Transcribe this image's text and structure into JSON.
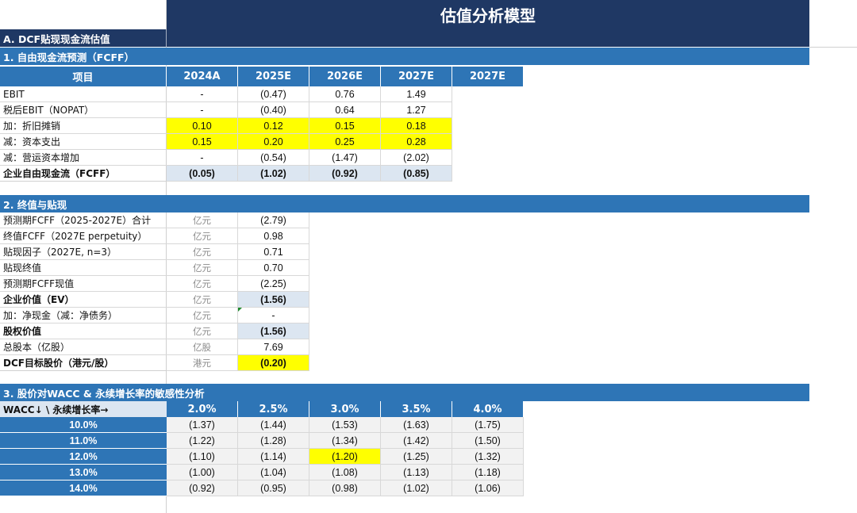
{
  "title": "估值分析模型",
  "sectionA": "A. DCF贴现现金流估值",
  "section1": {
    "heading": "1. 自由现金流预测（FCFF）",
    "col_label": "项目",
    "years": [
      "2024A",
      "2025E",
      "2026E",
      "2027E",
      "2027E"
    ],
    "rows": [
      {
        "label": "EBIT",
        "values": [
          "-",
          "(0.47)",
          "0.76",
          "1.49"
        ]
      },
      {
        "label": "税后EBIT（NOPAT）",
        "values": [
          "-",
          "(0.40)",
          "0.64",
          "1.27"
        ]
      },
      {
        "label": "加：折旧摊销",
        "values": [
          "0.10",
          "0.12",
          "0.15",
          "0.18"
        ]
      },
      {
        "label": "减：资本支出",
        "values": [
          "0.15",
          "0.20",
          "0.25",
          "0.28"
        ]
      },
      {
        "label": "减：营运资本增加",
        "values": [
          "-",
          "(0.54)",
          "(1.47)",
          "(2.02)"
        ]
      },
      {
        "label": "企业自由现金流（FCFF）",
        "values": [
          "(0.05)",
          "(1.02)",
          "(0.92)",
          "(0.85)"
        ]
      }
    ]
  },
  "section2": {
    "heading": "2. 终值与贴现",
    "rows": [
      {
        "label": "预测期FCFF（2025-2027E）合计",
        "unit": "亿元",
        "value": "(2.79)"
      },
      {
        "label": "终值FCFF（2027E perpetuity）",
        "unit": "亿元",
        "value": "0.98"
      },
      {
        "label": "贴现因子（2027E, n=3）",
        "unit": "亿元",
        "value": "0.71"
      },
      {
        "label": "贴现终值",
        "unit": "亿元",
        "value": "0.70"
      },
      {
        "label": "预测期FCFF现值",
        "unit": "亿元",
        "value": "(2.25)"
      },
      {
        "label": "企业价值（EV）",
        "unit": "亿元",
        "value": "(1.56)"
      },
      {
        "label": "加：净现金（减：净债务）",
        "unit": "亿元",
        "value": "-"
      },
      {
        "label": "股权价值",
        "unit": "亿元",
        "value": "(1.56)"
      },
      {
        "label": "总股本（亿股）",
        "unit": "亿股",
        "value": "7.69"
      },
      {
        "label": "DCF目标股价（港元/股）",
        "unit": "港元",
        "value": "(0.20)"
      }
    ]
  },
  "section3": {
    "heading": "3. 股价对WACC & 永续增长率的敏感性分析",
    "corner": "WACC↓ \\ 永续增长率→",
    "growth": [
      "2.0%",
      "2.5%",
      "3.0%",
      "3.5%",
      "4.0%"
    ],
    "rows": [
      {
        "wacc": "10.0%",
        "values": [
          "(1.37)",
          "(1.44)",
          "(1.53)",
          "(1.63)",
          "(1.75)"
        ]
      },
      {
        "wacc": "11.0%",
        "values": [
          "(1.22)",
          "(1.28)",
          "(1.34)",
          "(1.42)",
          "(1.50)"
        ]
      },
      {
        "wacc": "12.0%",
        "values": [
          "(1.10)",
          "(1.14)",
          "(1.20)",
          "(1.25)",
          "(1.32)"
        ]
      },
      {
        "wacc": "13.0%",
        "values": [
          "(1.00)",
          "(1.04)",
          "(1.08)",
          "(1.13)",
          "(1.18)"
        ]
      },
      {
        "wacc": "14.0%",
        "values": [
          "(0.92)",
          "(0.95)",
          "(0.98)",
          "(1.02)",
          "(1.06)"
        ]
      }
    ]
  },
  "colors": {
    "dark_navy": "#1f3864",
    "header_blue": "#2e75b6",
    "highlight_yellow": "#ffff00",
    "light_blue": "#dce6f1"
  }
}
